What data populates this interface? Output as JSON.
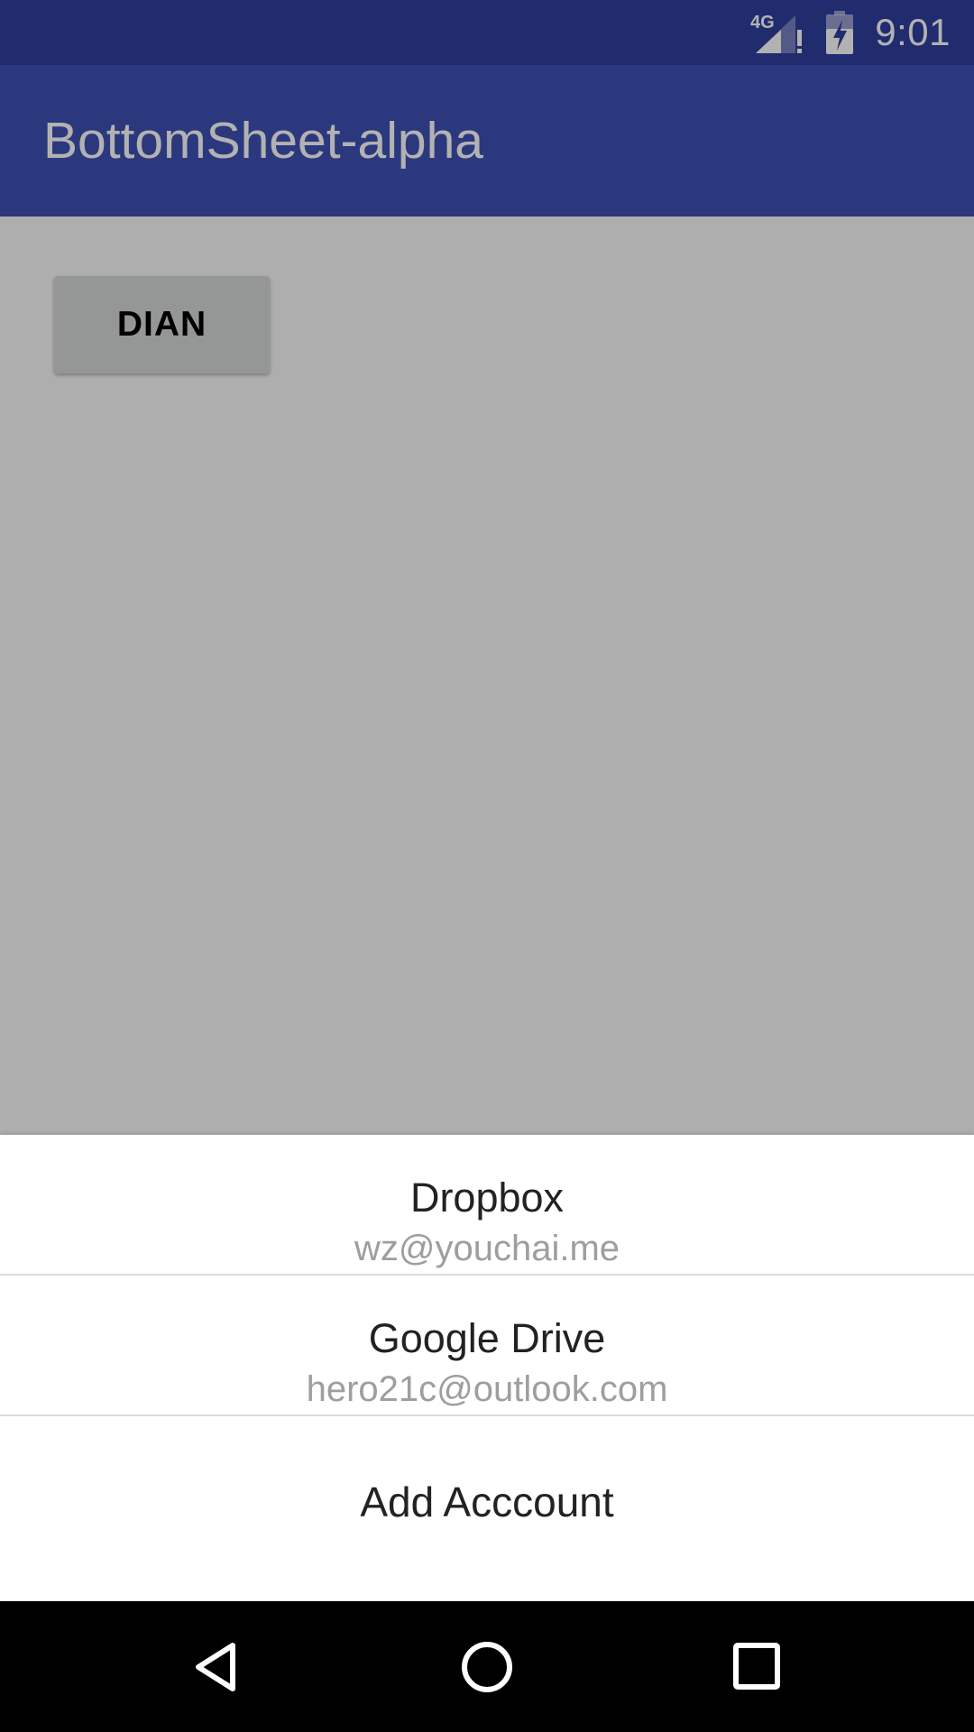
{
  "status_bar": {
    "network_label": "4G",
    "time": "9:01"
  },
  "app_bar": {
    "title": "BottomSheet-alpha"
  },
  "content": {
    "button_label": "DIAN"
  },
  "bottom_sheet": {
    "accounts": [
      {
        "title": "Dropbox",
        "subtitle": "wz@youchai.me"
      },
      {
        "title": "Google Drive",
        "subtitle": "hero21c@outlook.com"
      }
    ],
    "add_label": "Add Acccount"
  },
  "nav_bar": {
    "icons": [
      "back-icon",
      "home-icon",
      "recents-icon"
    ]
  },
  "colors": {
    "status_bar": "#303f9f",
    "app_bar": "#3f51b5",
    "scrim": "rgba(0,0,0,0.30)",
    "sheet_bg": "#ffffff",
    "secondary_text": "#9e9e9e",
    "nav_bar": "#000000"
  }
}
